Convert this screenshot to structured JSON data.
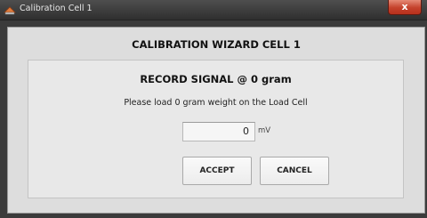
{
  "window": {
    "title": "Calibration Cell 1",
    "close_label": "x",
    "app_icon": "app-icon"
  },
  "wizard": {
    "title": "CALIBRATION WIZARD CELL 1",
    "step_heading": "RECORD SIGNAL @ 0 gram",
    "instruction": "Please load 0 gram weight on the Load Cell",
    "signal": {
      "value": "0",
      "unit": "mV"
    },
    "buttons": {
      "accept": "ACCEPT",
      "cancel": "CANCEL"
    }
  },
  "colors": {
    "titlebar": "#3b3b3b",
    "close_button": "#c4412b",
    "dialog_bg": "#dddddd",
    "panel_bg": "#e8e8e8"
  }
}
